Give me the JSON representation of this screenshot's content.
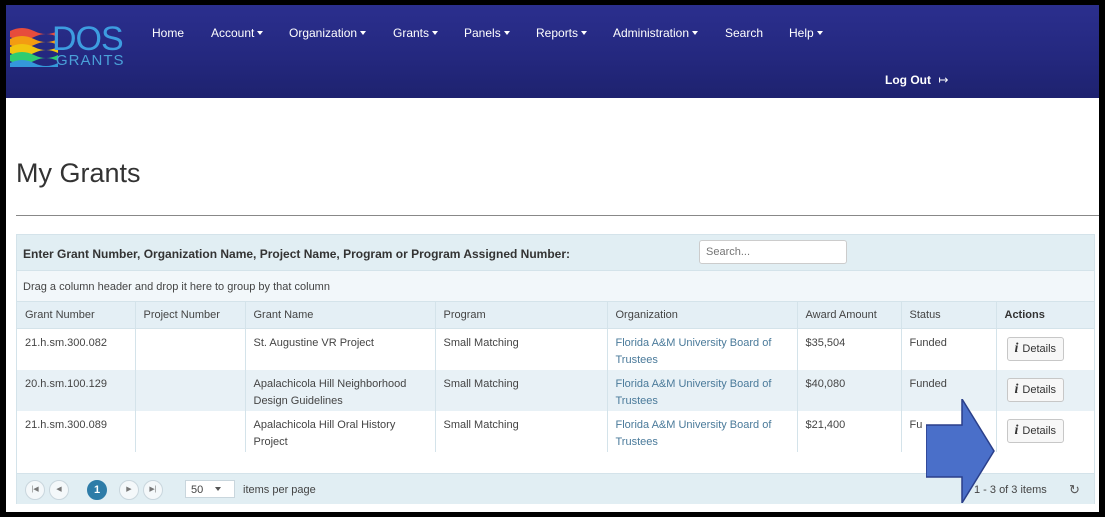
{
  "brand": {
    "logo_text": "DOS",
    "logo_sub": "GRANTS"
  },
  "nav": {
    "items": [
      {
        "label": "Home",
        "dropdown": false
      },
      {
        "label": "Account",
        "dropdown": true
      },
      {
        "label": "Organization",
        "dropdown": true
      },
      {
        "label": "Grants",
        "dropdown": true
      },
      {
        "label": "Panels",
        "dropdown": true
      },
      {
        "label": "Reports",
        "dropdown": true
      },
      {
        "label": "Administration",
        "dropdown": true
      },
      {
        "label": "Search",
        "dropdown": false
      },
      {
        "label": "Help",
        "dropdown": true
      }
    ],
    "logout_label": "Log Out",
    "logout_icon": "↦"
  },
  "page": {
    "title": "My Grants"
  },
  "search": {
    "label": "Enter Grant Number, Organization Name, Project Name, Program or Program Assigned Number:",
    "placeholder": "Search..."
  },
  "grid": {
    "group_hint": "Drag a column header and drop it here to group by that column",
    "columns": [
      "Grant Number",
      "Project Number",
      "Grant Name",
      "Program",
      "Organization",
      "Award Amount",
      "Status",
      "Actions"
    ],
    "rows": [
      {
        "grant_number": "21.h.sm.300.082",
        "project_number": "",
        "grant_name": "St. Augustine VR Project",
        "program": "Small Matching",
        "organization": "Florida A&M University Board of Trustees",
        "award_amount": "$35,504",
        "status": "Funded",
        "action": "Details"
      },
      {
        "grant_number": "20.h.sm.100.129",
        "project_number": "",
        "grant_name": "Apalachicola Hill Neighborhood Design Guidelines",
        "program": "Small Matching",
        "organization": "Florida A&M University Board of Trustees",
        "award_amount": "$40,080",
        "status": "Funded",
        "action": "Details"
      },
      {
        "grant_number": "21.h.sm.300.089",
        "project_number": "",
        "grant_name": "Apalachicola Hill Oral History Project",
        "program": "Small Matching",
        "organization": "Florida A&M University Board of Trustees",
        "award_amount": "$21,400",
        "status": "Fu",
        "action": "Details"
      }
    ]
  },
  "pager": {
    "current_page": "1",
    "page_size": "50",
    "items_per_page_label": "items per page",
    "info": "1 - 3 of 3 items"
  },
  "colors": {
    "navbar": "#24287f",
    "header_row": "#e4eff5",
    "alt_row": "#e8f1f6",
    "org_link": "#4a7a9a",
    "active_page": "#2e7ca8",
    "callout_arrow": "#4a6fc9"
  }
}
